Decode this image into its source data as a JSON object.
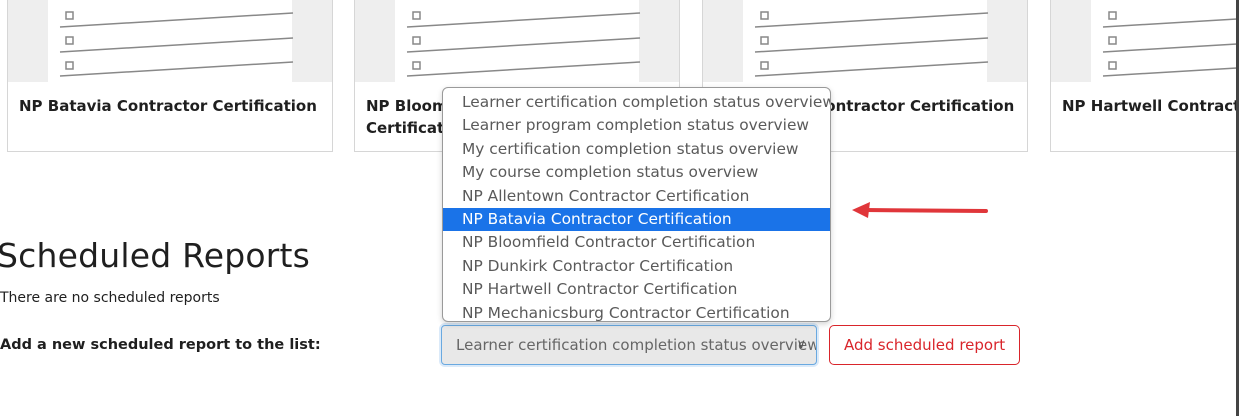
{
  "cards": [
    {
      "title": "NP Batavia Contractor Certification"
    },
    {
      "title": "NP Bloomfield Contractor Certification"
    },
    {
      "title": "NP Dunkirk Contractor Certification"
    },
    {
      "title": "NP Hartwell Contractor Certification"
    }
  ],
  "scheduled": {
    "heading": "Scheduled Reports",
    "empty_message": "There are no scheduled reports",
    "add_label": "Add a new scheduled report to the list:",
    "select_value": "Learner certification completion status overview",
    "add_button": "Add scheduled report"
  },
  "dropdown": {
    "options": [
      "Learner certification completion status overview",
      "Learner program completion status overview",
      "My certification completion status overview",
      "My course completion status overview",
      "NP Allentown Contractor Certification",
      "NP Batavia Contractor Certification",
      "NP Bloomfield Contractor Certification",
      "NP Dunkirk Contractor Certification",
      "NP Hartwell Contractor Certification",
      "NP Mechanicsburg Contractor Certification"
    ],
    "highlighted_index": 5
  },
  "colors": {
    "accent": "#1a73e8",
    "danger": "#d9252b",
    "arrow": "#e0363a"
  }
}
